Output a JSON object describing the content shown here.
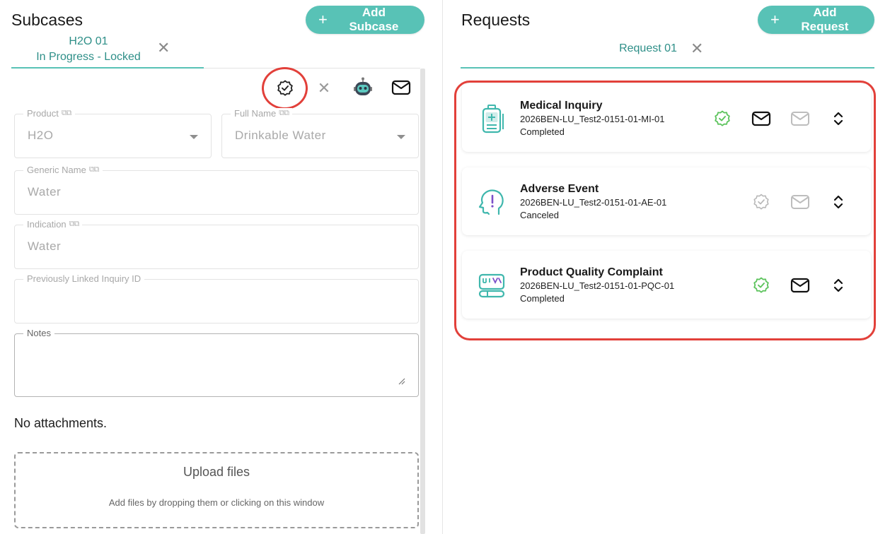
{
  "subcases": {
    "title": "Subcases",
    "add_label": "Add Subcase",
    "tab": {
      "name": "H2O 01",
      "status": "In Progress - Locked"
    }
  },
  "form": {
    "product": {
      "label": "Product",
      "value": "H2O"
    },
    "full_name": {
      "label": "Full Name",
      "value": "Drinkable Water"
    },
    "generic_name": {
      "label": "Generic Name",
      "value": "Water"
    },
    "indication": {
      "label": "Indication",
      "value": "Water"
    },
    "linked_inquiry": {
      "label": "Previously Linked Inquiry ID",
      "value": ""
    },
    "notes": {
      "label": "Notes",
      "value": ""
    }
  },
  "attachments": {
    "empty_text": "No attachments.",
    "upload_title": "Upload files",
    "upload_hint": "Add files by dropping them or clicking on this window"
  },
  "requests": {
    "title": "Requests",
    "add_label": "Add Request",
    "tab": "Request 01",
    "items": [
      {
        "name": "Medical Inquiry",
        "id": "2026BEN-LU_Test2-0151-01-MI-01",
        "status": "Completed"
      },
      {
        "name": "Adverse Event",
        "id": "2026BEN-LU_Test2-0151-01-AE-01",
        "status": "Canceled"
      },
      {
        "name": "Product Quality Complaint",
        "id": "2026BEN-LU_Test2-0151-01-PQC-01",
        "status": "Completed"
      }
    ]
  },
  "colors": {
    "accent": "#58c2b6",
    "tab_text": "#2e8f88",
    "highlight": "#e2403a",
    "success": "#5cc35c"
  }
}
